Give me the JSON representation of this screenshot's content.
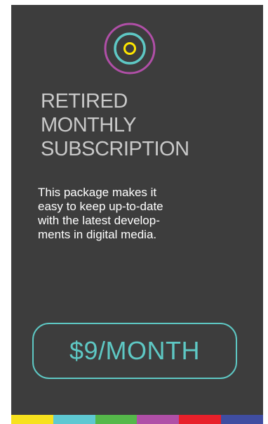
{
  "logo": {
    "icon": "target-rings-icon",
    "outer_color": "#b04fa7",
    "middle_color": "#5ec8c4",
    "inner_color": "#ffe600"
  },
  "plan": {
    "title_lines": [
      "RETIRED",
      "MONTHLY",
      "SUBSCRIPTION"
    ],
    "description_lines": [
      "This package makes it",
      "easy to keep up-to-date",
      "with the latest develop-",
      "ments in digital media."
    ],
    "price": "$9/MONTH"
  },
  "color_bar": [
    "#f7e11e",
    "#5ec8d2",
    "#55b84a",
    "#b04fa7",
    "#e8202a",
    "#3f4da1"
  ]
}
